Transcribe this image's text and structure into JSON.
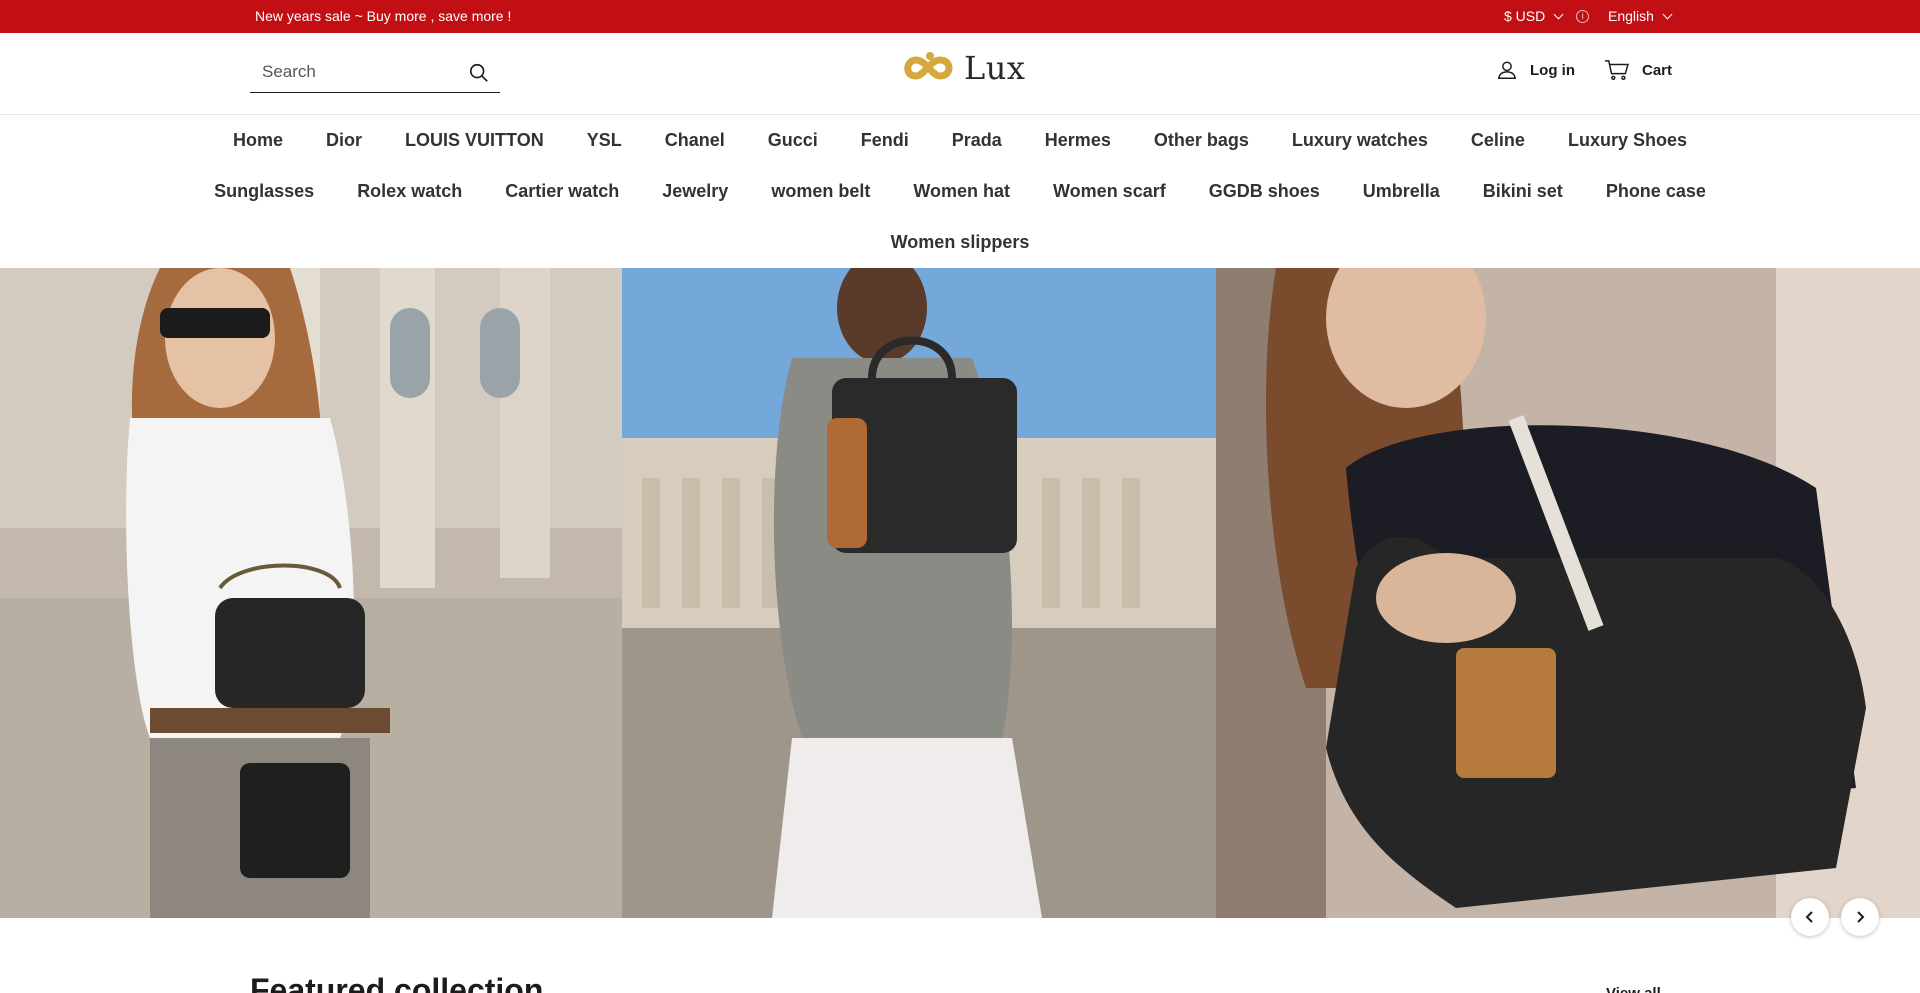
{
  "announcement": {
    "message": "New years sale ~ Buy more , save more !",
    "currency": "$ USD",
    "language": "English"
  },
  "header": {
    "search_placeholder": "Search",
    "logo_text": "Lux",
    "login_label": "Log in",
    "cart_label": "Cart"
  },
  "nav": {
    "row1": [
      "Home",
      "Dior",
      "LOUIS VUITTON",
      "YSL",
      "Chanel",
      "Gucci",
      "Fendi",
      "Prada",
      "Hermes",
      "Other bags",
      "Luxury watches",
      "Celine",
      "Luxury Shoes"
    ],
    "row2": [
      "Sunglasses",
      "Rolex watch",
      "Cartier watch",
      "Jewelry",
      "women belt",
      "Women hat",
      "Women scarf",
      "GGDB shoes",
      "Umbrella",
      "Bikini set",
      "Phone case"
    ],
    "row3": [
      "Women slippers"
    ]
  },
  "featured": {
    "title": "Featured collection",
    "view_all": "View all"
  },
  "colors": {
    "announcement_bg": "#c20f14",
    "logo_gold": "#d4a83a"
  },
  "icons": [
    "search-icon",
    "user-icon",
    "cart-icon",
    "chevron-left-icon",
    "chevron-right-icon",
    "info-icon",
    "chevron-down-icon"
  ]
}
